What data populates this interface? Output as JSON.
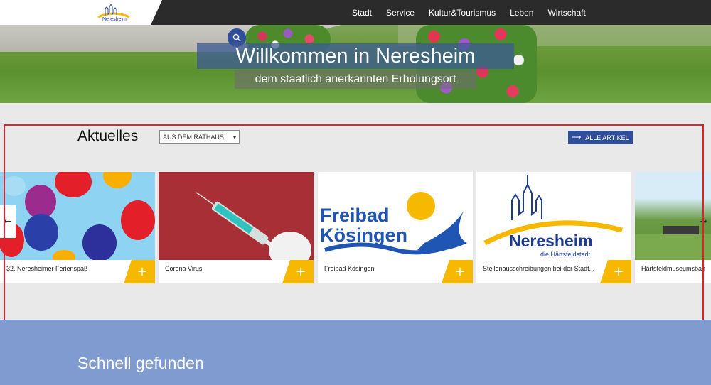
{
  "header": {
    "logo_text": "Neresheim",
    "nav": [
      "Stadt",
      "Service",
      "Kultur&Tourismus",
      "Leben",
      "Wirtschaft"
    ]
  },
  "hero": {
    "title": "Willkommen in Neresheim",
    "subtitle": "dem staatlich anerkannten Erholungsort"
  },
  "aktuelles": {
    "title": "Aktuelles",
    "filter_selected": "AUS DEM RATHAUS",
    "all_articles_label": "ALLE ARTIKEL",
    "cards": [
      {
        "caption": "32. Neresheimer Ferienspaß"
      },
      {
        "caption": "Corona Virus"
      },
      {
        "caption": "Freibad Kösingen"
      },
      {
        "caption": "Stellenausschreibungen bei der Stadt..."
      },
      {
        "caption": "Härtsfeldmuseumsbah"
      }
    ],
    "freibad_logo": {
      "line1": "Freibad",
      "line2": "Kösingen"
    },
    "neresheim_logo": {
      "name": "Neresheim",
      "tagline": "die Härtsfeldstadt"
    },
    "plus_symbol": "+"
  },
  "schnell": {
    "title": "Schnell gefunden"
  },
  "colors": {
    "nav_bg": "#2b2b2b",
    "accent_blue": "#2f4f9a",
    "accent_yellow": "#f6b800",
    "section_blue": "#7f9bd0",
    "highlight_red": "#e0202a"
  }
}
